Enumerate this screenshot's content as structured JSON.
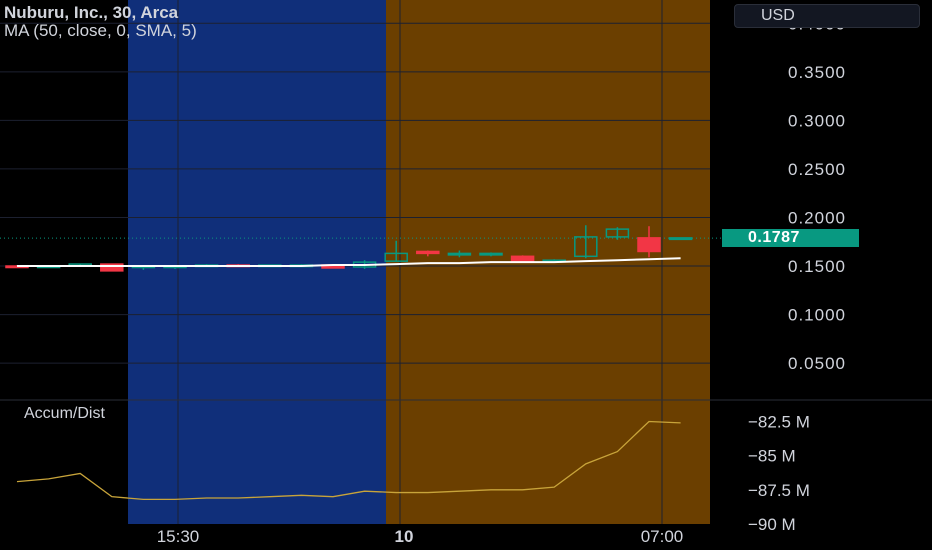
{
  "header": {
    "title": "Nuburu, Inc., 30, Arca",
    "ma_label": "MA (50, close, 0, SMA, 5)",
    "currency": "USD"
  },
  "last_price_label": "0.1787",
  "indicator_label": "Accum/Dist",
  "colors": {
    "up": "#089981",
    "down": "#f23645",
    "ma": "#ffffff",
    "ad": "#c8a43a",
    "session_blue": "#102f7a",
    "session_orange": "#6b3f00"
  },
  "chart_data": [
    {
      "type": "candlestick",
      "title": "Nuburu, Inc., 30, Arca",
      "y_ticks": [
        "0.0500",
        "0.1000",
        "0.1500",
        "0.2000",
        "0.2500",
        "0.3000",
        "0.3500",
        "0.4000"
      ],
      "ylim": [
        0.012,
        0.424
      ],
      "last_price": 0.1787,
      "x_ticks": [
        "15:30",
        "10",
        "07:00"
      ],
      "candles": [
        {
          "o": 0.15,
          "h": 0.151,
          "l": 0.149,
          "c": 0.149
        },
        {
          "o": 0.15,
          "h": 0.151,
          "l": 0.149,
          "c": 0.15
        },
        {
          "o": 0.15,
          "h": 0.152,
          "l": 0.149,
          "c": 0.152
        },
        {
          "o": 0.152,
          "h": 0.152,
          "l": 0.145,
          "c": 0.145
        },
        {
          "o": 0.149,
          "h": 0.151,
          "l": 0.146,
          "c": 0.15
        },
        {
          "o": 0.149,
          "h": 0.151,
          "l": 0.147,
          "c": 0.15
        },
        {
          "o": 0.15,
          "h": 0.152,
          "l": 0.149,
          "c": 0.151
        },
        {
          "o": 0.151,
          "h": 0.152,
          "l": 0.15,
          "c": 0.15
        },
        {
          "o": 0.15,
          "h": 0.151,
          "l": 0.149,
          "c": 0.151
        },
        {
          "o": 0.151,
          "h": 0.152,
          "l": 0.15,
          "c": 0.151
        },
        {
          "o": 0.151,
          "h": 0.151,
          "l": 0.148,
          "c": 0.148
        },
        {
          "o": 0.149,
          "h": 0.156,
          "l": 0.147,
          "c": 0.154
        },
        {
          "o": 0.155,
          "h": 0.176,
          "l": 0.155,
          "c": 0.163
        },
        {
          "o": 0.165,
          "h": 0.166,
          "l": 0.16,
          "c": 0.163
        },
        {
          "o": 0.163,
          "h": 0.166,
          "l": 0.159,
          "c": 0.163
        },
        {
          "o": 0.162,
          "h": 0.164,
          "l": 0.16,
          "c": 0.163
        },
        {
          "o": 0.16,
          "h": 0.161,
          "l": 0.155,
          "c": 0.155
        },
        {
          "o": 0.155,
          "h": 0.157,
          "l": 0.154,
          "c": 0.156
        },
        {
          "o": 0.16,
          "h": 0.192,
          "l": 0.158,
          "c": 0.18
        },
        {
          "o": 0.18,
          "h": 0.19,
          "l": 0.177,
          "c": 0.188
        },
        {
          "o": 0.179,
          "h": 0.191,
          "l": 0.159,
          "c": 0.165
        },
        {
          "o": 0.179,
          "h": 0.179,
          "l": 0.178,
          "c": 0.179
        }
      ],
      "ma": [
        0.15,
        0.15,
        0.15,
        0.15,
        0.15,
        0.15,
        0.15,
        0.15,
        0.15,
        0.15,
        0.151,
        0.151,
        0.152,
        0.153,
        0.153,
        0.154,
        0.154,
        0.154,
        0.155,
        0.156,
        0.157,
        0.158
      ]
    },
    {
      "type": "line",
      "title": "Accum/Dist",
      "y_ticks": [
        "−82.5 M",
        "−85 M",
        "−87.5 M",
        "−90 M"
      ],
      "ylim": [
        -90.0,
        -81.0
      ],
      "values": [
        -86.9,
        -86.7,
        -86.3,
        -88.0,
        -88.2,
        -88.2,
        -88.1,
        -88.1,
        -88.0,
        -87.9,
        -88.0,
        -87.6,
        -87.7,
        -87.7,
        -87.6,
        -87.5,
        -87.5,
        -87.3,
        -85.6,
        -84.7,
        -82.5,
        -82.6
      ]
    }
  ]
}
